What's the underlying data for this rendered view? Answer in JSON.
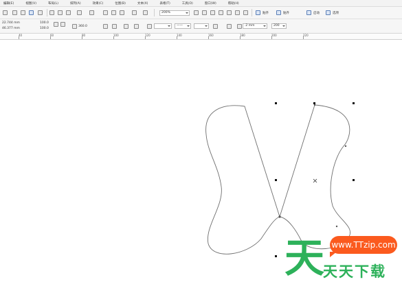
{
  "menubar": {
    "items": [
      "编辑(E)",
      "视图(V)",
      "布局(L)",
      "排列(A)",
      "效果(C)",
      "位图(B)",
      "文本(X)",
      "表格(T)",
      "工具(O)",
      "窗口(W)",
      "帮助(H)"
    ]
  },
  "toolbar": {
    "zoom_value": "200%",
    "snap_label": "贴齐",
    "dynamic_guides_label": "贴齐",
    "launch_label": "启动",
    "options_label": "选项"
  },
  "property_bar": {
    "x_value": "22.744 mm",
    "y_value": "46.377 mm",
    "width_percent": "100.0",
    "height_percent": "100.0",
    "rotation_value": "360.0",
    "outline_width": ".2 mm",
    "line_style_value": "——",
    "end_value": "200"
  },
  "ruler": {
    "labels": [
      "40",
      "60",
      "80",
      "100",
      "120",
      "140",
      "160",
      "180",
      "200",
      "220"
    ]
  },
  "watermark": {
    "brand_char": "天",
    "url_text": "www.TTzip.com",
    "site_name": "天天下载"
  },
  "colors": {
    "watermark_green": "#2db15a",
    "watermark_orange": "#fb5a1e"
  }
}
